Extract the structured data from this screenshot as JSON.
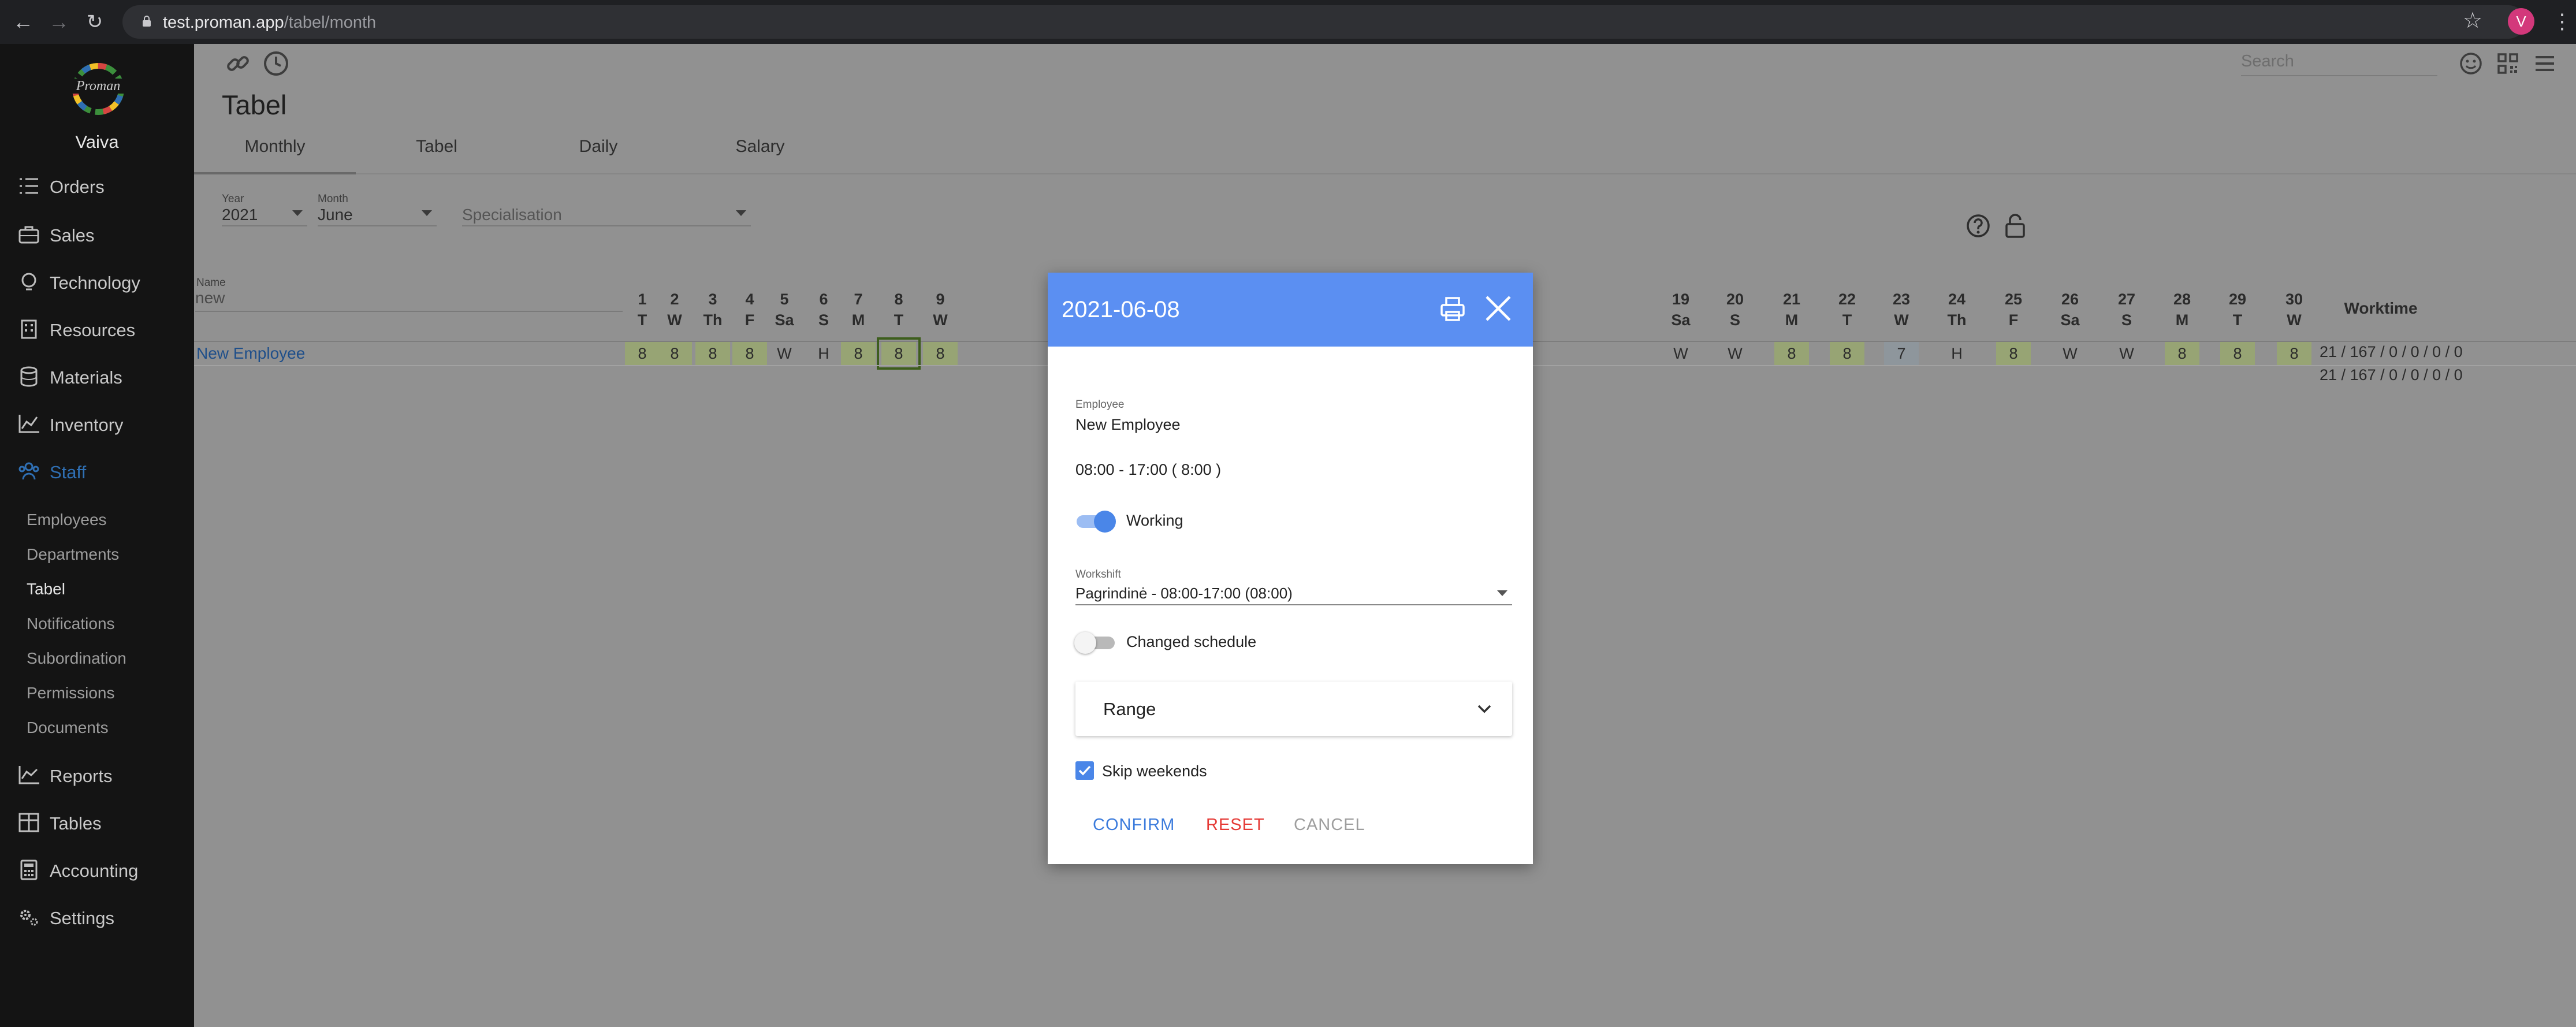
{
  "browser": {
    "url_host": "test.proman.app",
    "url_path": "/tabel/month",
    "profile_initial": "V"
  },
  "sidebar": {
    "logo_text": "Proman",
    "user_name": "Vaiva",
    "items": [
      {
        "label": "Orders",
        "icon": "orders-list-icon"
      },
      {
        "label": "Sales",
        "icon": "briefcase-icon"
      },
      {
        "label": "Technology",
        "icon": "lightbulb-icon"
      },
      {
        "label": "Resources",
        "icon": "building-icon"
      },
      {
        "label": "Materials",
        "icon": "database-icon"
      },
      {
        "label": "Inventory",
        "icon": "chart-icon"
      },
      {
        "label": "Staff",
        "icon": "people-icon",
        "active": true
      }
    ],
    "sub_items": [
      {
        "label": "Employees"
      },
      {
        "label": "Departments"
      },
      {
        "label": "Tabel",
        "active": true
      },
      {
        "label": "Notifications"
      },
      {
        "label": "Subordination"
      },
      {
        "label": "Permissions"
      },
      {
        "label": "Documents"
      }
    ],
    "bottom_items": [
      {
        "label": "Reports",
        "icon": "report-chart-icon"
      },
      {
        "label": "Tables",
        "icon": "table-icon"
      },
      {
        "label": "Accounting",
        "icon": "calculator-icon"
      },
      {
        "label": "Settings",
        "icon": "gears-icon"
      }
    ]
  },
  "toolbar": {
    "search_placeholder": "Search"
  },
  "page": {
    "title": "Tabel",
    "tabs": [
      "Monthly",
      "Tabel",
      "Daily",
      "Salary"
    ],
    "active_tab": "Monthly"
  },
  "filters": {
    "year": {
      "label": "Year",
      "value": "2021"
    },
    "month": {
      "label": "Month",
      "value": "June"
    },
    "specialisation": {
      "placeholder": "Specialisation"
    }
  },
  "grid": {
    "name_label": "Name",
    "name_filter_value": "new",
    "worktime_header": "Worktime",
    "days": [
      {
        "num": "1",
        "dow": "T",
        "val": "8",
        "type": "work"
      },
      {
        "num": "2",
        "dow": "W",
        "val": "8",
        "type": "work"
      },
      {
        "num": "3",
        "dow": "Th",
        "val": "8",
        "type": "work"
      },
      {
        "num": "4",
        "dow": "F",
        "val": "8",
        "type": "work"
      },
      {
        "num": "5",
        "dow": "Sa",
        "val": "W",
        "type": "off"
      },
      {
        "num": "6",
        "dow": "S",
        "val": "H",
        "type": "off"
      },
      {
        "num": "7",
        "dow": "M",
        "val": "8",
        "type": "work"
      },
      {
        "num": "8",
        "dow": "T",
        "val": "8",
        "type": "work",
        "selected": true
      },
      {
        "num": "9",
        "dow": "W",
        "val": "8",
        "type": "work"
      }
    ],
    "days_right": [
      {
        "num": "19",
        "dow": "Sa",
        "val": "W",
        "type": "off"
      },
      {
        "num": "20",
        "dow": "S",
        "val": "W",
        "type": "off"
      },
      {
        "num": "21",
        "dow": "M",
        "val": "8",
        "type": "work"
      },
      {
        "num": "22",
        "dow": "T",
        "val": "8",
        "type": "work"
      },
      {
        "num": "23",
        "dow": "W",
        "val": "7",
        "type": "partial"
      },
      {
        "num": "24",
        "dow": "Th",
        "val": "H",
        "type": "off"
      },
      {
        "num": "25",
        "dow": "F",
        "val": "8",
        "type": "work"
      },
      {
        "num": "26",
        "dow": "Sa",
        "val": "W",
        "type": "off"
      },
      {
        "num": "27",
        "dow": "S",
        "val": "W",
        "type": "off"
      },
      {
        "num": "28",
        "dow": "M",
        "val": "8",
        "type": "work"
      },
      {
        "num": "29",
        "dow": "T",
        "val": "8",
        "type": "work"
      },
      {
        "num": "30",
        "dow": "W",
        "val": "8",
        "type": "work"
      }
    ],
    "employee_name": "New Employee",
    "worktime_row": "21 / 167 / 0 / 0 / 0 / 0",
    "worktime_total": "21 / 167 / 0 / 0 / 0 / 0"
  },
  "dialog": {
    "title": "2021-06-08",
    "employee_label": "Employee",
    "employee_value": "New Employee",
    "time_range": "08:00 - 17:00 ( 8:00 )",
    "working_label": "Working",
    "working_on": true,
    "workshift_label": "Workshift",
    "workshift_value": "Pagrindinė - 08:00-17:00 (08:00)",
    "changed_schedule_label": "Changed schedule",
    "changed_schedule_on": false,
    "range_label": "Range",
    "skip_weekends_label": "Skip weekends",
    "skip_weekends_checked": true,
    "confirm_label": "CONFIRM",
    "reset_label": "RESET",
    "cancel_label": "CANCEL"
  },
  "colors": {
    "accent": "#5b8ff2",
    "confirm": "#3b7bdc",
    "reset": "#e53935",
    "cancel": "#9e9e9e",
    "work_day": "#97a474",
    "annotation_arrow": "#4b6f1e"
  }
}
